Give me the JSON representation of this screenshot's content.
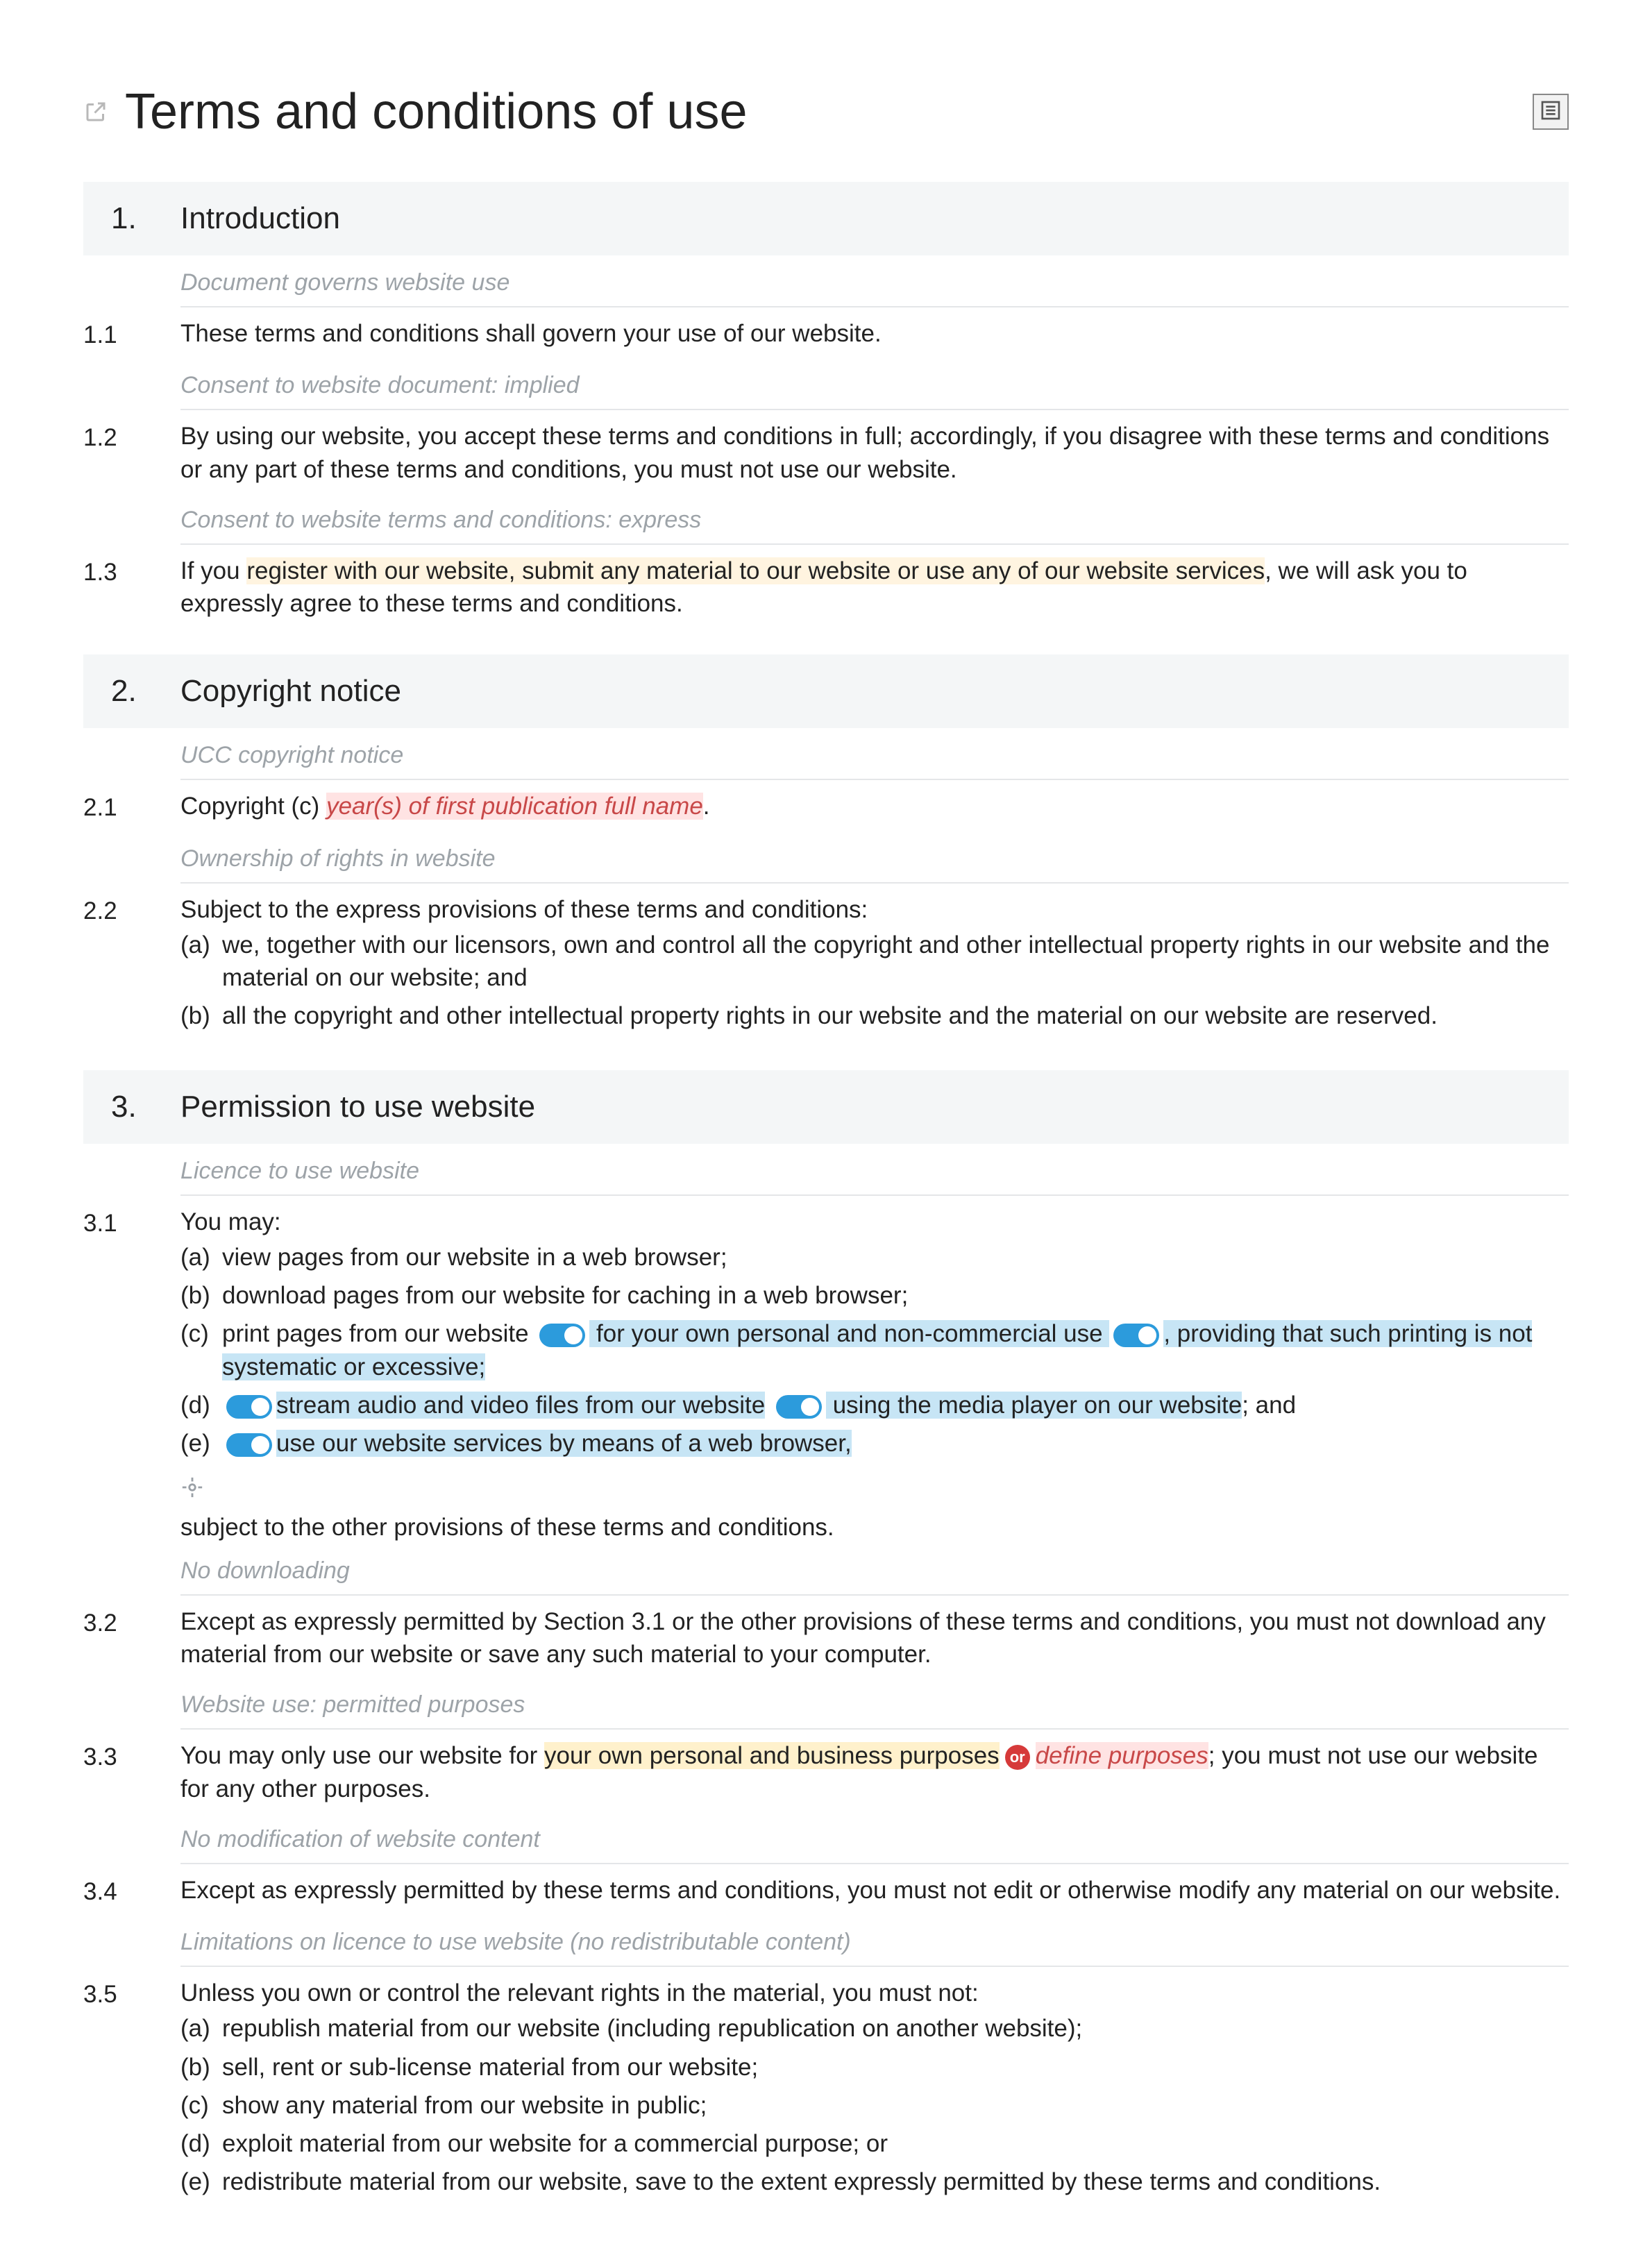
{
  "title": "Terms and conditions of use",
  "sections": [
    {
      "num": "1.",
      "title": "Introduction",
      "items": [
        {
          "type": "note",
          "text": "Document governs website use"
        },
        {
          "type": "clause",
          "num": "1.1",
          "text": "These terms and conditions shall govern your use of our website."
        },
        {
          "type": "note",
          "text": "Consent to website document: implied"
        },
        {
          "type": "clause",
          "num": "1.2",
          "text": "By using our website, you accept these terms and conditions in full; accordingly, if you disagree with these terms and conditions or any part of these terms and conditions, you must not use our website."
        },
        {
          "type": "note",
          "text": "Consent to website terms and conditions: express"
        },
        {
          "type": "clause",
          "num": "1.3",
          "parts": [
            {
              "t": "If you "
            },
            {
              "t": "register with our website, submit any material to our website or use any of our website services",
              "hl": "yellow"
            },
            {
              "t": ", we will ask you to expressly agree to these terms and conditions."
            }
          ]
        }
      ]
    },
    {
      "num": "2.",
      "title": "Copyright notice",
      "items": [
        {
          "type": "note",
          "text": "UCC copyright notice"
        },
        {
          "type": "clause",
          "num": "2.1",
          "parts": [
            {
              "t": "Copyright (c) "
            },
            {
              "t": "year(s) of first publication full name",
              "hl": "pink"
            },
            {
              "t": "."
            }
          ]
        },
        {
          "type": "note",
          "text": "Ownership of rights in website"
        },
        {
          "type": "clause",
          "num": "2.2",
          "text": "Subject to the express provisions of these terms and conditions:",
          "subs": [
            {
              "label": "(a)",
              "text": "we, together with our licensors, own and control all the copyright and other intellectual property rights in our website and the material on our website; and"
            },
            {
              "label": "(b)",
              "text": "all the copyright and other intellectual property rights in our website and the material on our website are reserved."
            }
          ]
        }
      ]
    },
    {
      "num": "3.",
      "title": "Permission to use website",
      "items": [
        {
          "type": "note",
          "text": "Licence to use website"
        },
        {
          "type": "clause31"
        },
        {
          "type": "note",
          "text": "No downloading"
        },
        {
          "type": "clause",
          "num": "3.2",
          "text": "Except as expressly permitted by Section 3.1 or the other provisions of these terms and conditions, you must not download any material from our website or save any such material to your computer."
        },
        {
          "type": "note",
          "text": "Website use: permitted purposes"
        },
        {
          "type": "clause33"
        },
        {
          "type": "note",
          "text": "No modification of website content"
        },
        {
          "type": "clause",
          "num": "3.4",
          "text": "Except as expressly permitted by these terms and conditions, you must not edit or otherwise modify any material on our website."
        },
        {
          "type": "note",
          "text": "Limitations on licence to use website (no redistributable content)"
        },
        {
          "type": "clause",
          "num": "3.5",
          "text": "Unless you own or control the relevant rights in the material, you must not:",
          "subs": [
            {
              "label": "(a)",
              "text": "republish material from our website (including republication on another website);"
            },
            {
              "label": "(b)",
              "text": "sell, rent or sub-license material from our website;"
            },
            {
              "label": "(c)",
              "text": "show any material from our website in public;"
            },
            {
              "label": "(d)",
              "text": "exploit material from our website for a commercial purpose; or"
            },
            {
              "label": "(e)",
              "text": "redistribute material from our website, save to the extent expressly permitted by these terms and conditions."
            }
          ]
        }
      ]
    }
  ],
  "c31": {
    "num": "3.1",
    "lead": "You may:",
    "a": "view pages from our website in a web browser;",
    "b": "download pages from our website for caching in a web browser;",
    "c_pre": "print pages from our website",
    "c_mid": " for your own personal and non-commercial use ",
    "c_post": ", providing that such printing is not systematic or excessive;",
    "d_pre": "stream audio and video files from our website",
    "d_mid": " using the media player on our website",
    "d_post": "; and",
    "e": "use our website services by means of a web browser,",
    "tail": "subject to the other provisions of these terms and conditions."
  },
  "c33": {
    "num": "3.3",
    "pre": "You may only use our website for ",
    "opt1": "your own personal and business purposes",
    "or": "or",
    "opt2": "define purposes",
    "post": "; you must not use our website for any other purposes."
  }
}
